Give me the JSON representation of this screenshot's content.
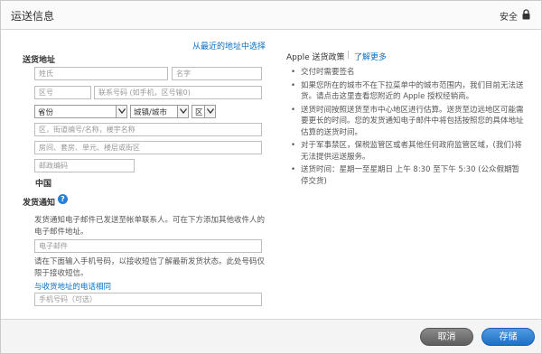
{
  "header": {
    "title": "运送信息",
    "secure_label": "安全"
  },
  "address": {
    "recent_link": "从最近的地址中选择",
    "section_label": "送货地址",
    "placeholders": {
      "last_name": "姓氏",
      "first_name": "名字",
      "area_code": "区号",
      "phone": "联系号码 (如手机，区号输0)",
      "district": "区，街道编号/名称，楼宇名称",
      "building": "房间、套房、单元、楼层或街区",
      "postal_code": "邮政编码"
    },
    "province_value": "省份",
    "city_value": "城镇/城市",
    "district_value": "区",
    "country": "中国"
  },
  "notification": {
    "section_label": "发货通知",
    "help_icon_glyph": "?",
    "email_description": "发货通知电子邮件已发送至帐单联系人。可在下方添加其他收件人的电子邮件地址。",
    "email_placeholder": "电子邮件",
    "sms_description": "请在下面输入手机号码，以接收短信了解最新发货状态。此处号码仅限于接收短信。",
    "same_as_shipping_link": "与收货地址的电话相同",
    "mobile_placeholder": "手机号码（可选）"
  },
  "policy": {
    "title": "Apple 送货政策",
    "separator": "|",
    "learn_more": "了解更多",
    "items": [
      "交付时需要签名",
      "如果您所在的城市不在下拉菜单中的城市范围内，我们目前无法送货。请点击这里查看您附近的 Apple 授权经销商。",
      "送货时间按照送货至市中心地区进行估算。送货至边远地区可能需要更长的时间。您的发货通知电子邮件中将包括按照您的具体地址估算的送货时间。",
      "对于军事禁区，保税监管区或者其他任何政府监管区域，(我们)将无法提供运送服务。",
      "送货时间：星期一至星期日 上午 8:30 至下午 5:30 (公众假期暂停交货)"
    ]
  },
  "footer": {
    "cancel_label": "取消",
    "save_label": "存储"
  },
  "colors": {
    "link": "#0a6fc2",
    "save_button": "#1f6fc4",
    "cancel_button": "#6e6e6e"
  }
}
